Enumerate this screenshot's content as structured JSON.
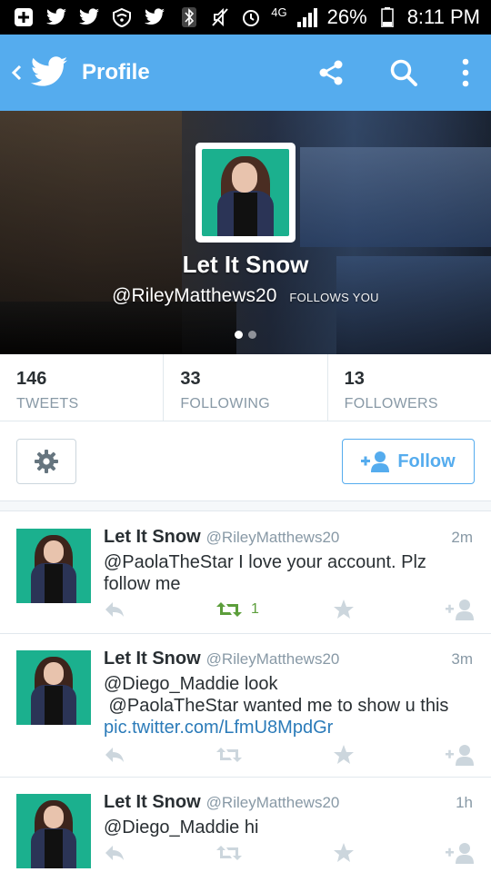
{
  "status_bar": {
    "network": "4G",
    "battery": "26%",
    "time": "8:11 PM"
  },
  "app_bar": {
    "title": "Profile"
  },
  "profile": {
    "name": "Let It Snow",
    "handle": "@RileyMatthews20",
    "follows_you_label": "FOLLOWS YOU"
  },
  "stats": [
    {
      "value": "146",
      "label": "TWEETS"
    },
    {
      "value": "33",
      "label": "FOLLOWING"
    },
    {
      "value": "13",
      "label": "FOLLOWERS"
    }
  ],
  "actions": {
    "follow_label": "Follow"
  },
  "tweets": [
    {
      "name": "Let It Snow",
      "handle": "@RileyMatthews20",
      "time": "2m",
      "text": "@PaolaTheStar I love your account. Plz follow me",
      "retweet_count": "1",
      "retweeted": true
    },
    {
      "name": "Let It Snow",
      "handle": "@RileyMatthews20",
      "time": "3m",
      "text_line1": "@Diego_Maddie look",
      "text_line2": " @PaolaTheStar wanted me to show u this",
      "link": "pic.twitter.com/LfmU8MpdGr",
      "retweet_count": "",
      "retweeted": false
    },
    {
      "name": "Let It Snow",
      "handle": "@RileyMatthews20",
      "time": "1h",
      "text": "@Diego_Maddie hi",
      "retweet_count": "",
      "retweeted": false
    }
  ],
  "colors": {
    "accent": "#55acee",
    "retweet_green": "#5c9e3b",
    "muted": "#8899a6",
    "link": "#2b7bb9"
  }
}
